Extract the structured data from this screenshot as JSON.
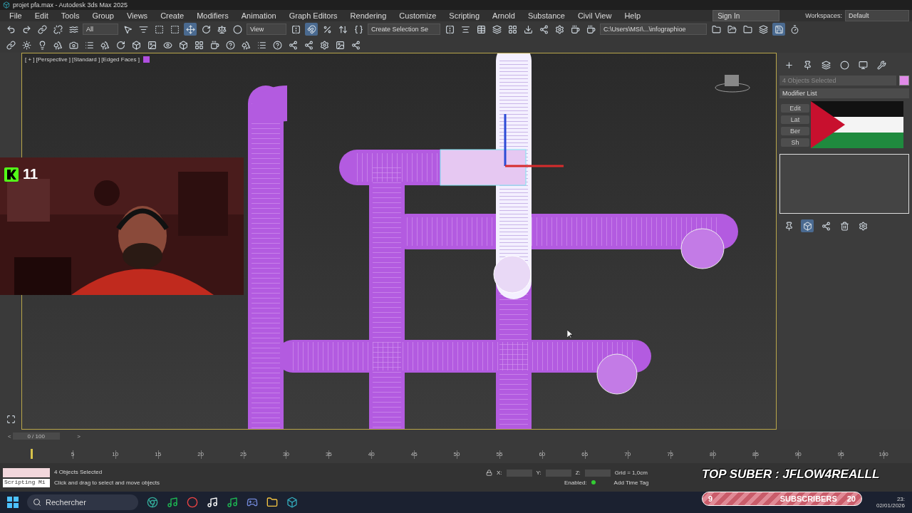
{
  "window": {
    "title": "projet pfa.max - Autodesk 3ds Max 2025"
  },
  "menu": [
    "File",
    "Edit",
    "Tools",
    "Group",
    "Views",
    "Create",
    "Modifiers",
    "Animation",
    "Graph Editors",
    "Rendering",
    "Customize",
    "Scripting",
    "Arnold",
    "Substance",
    "Civil View",
    "Help"
  ],
  "account": {
    "sign_in": "Sign In",
    "workspaces_label": "Workspaces:",
    "workspace": "Default"
  },
  "toolbar": {
    "selection_filter": "All",
    "reference_coord": "View",
    "named_selection": "Create Selection Se",
    "project_path": "C:\\Users\\MSI\\...\\infographioe"
  },
  "viewport": {
    "labels": [
      "[ + ]",
      "[Perspective ]",
      "[Standard ]",
      "[Edged Faces ]"
    ]
  },
  "webcam_overlay": {
    "count": "11"
  },
  "command_panel": {
    "selection": "4 Objects Selected",
    "modifier_list": "Modifier List",
    "modifier_buttons": [
      "Edit",
      "Lat",
      "Ber",
      "Sh"
    ]
  },
  "timeline": {
    "prev": "<",
    "frame": "0 / 100",
    "next": ">",
    "level": 0,
    "ticks": [
      "5",
      "10",
      "15",
      "20",
      "25",
      "30",
      "35",
      "40",
      "45",
      "50",
      "55",
      "60",
      "65",
      "70",
      "75",
      "80",
      "85",
      "90",
      "95",
      "100"
    ]
  },
  "status": {
    "script_listener": "Scripting Mi",
    "selection": "4 Objects Selected",
    "prompt": "Click and drag to select and move objects",
    "x_label": "X:",
    "y_label": "Y:",
    "z_label": "Z:",
    "grid": "Grid = 1,0cm",
    "enabled": "Enabled:",
    "time_tag": "Add Time Tag"
  },
  "stream_overlay": {
    "top_sub": "TOP SUBER : JFLOW4REALLL",
    "goal_count": "9",
    "goal_label": "SUBSCRIBERS",
    "goal_target": "20"
  },
  "taskbar": {
    "search": "Rechercher",
    "time": "23:",
    "date": "02/01/2026"
  }
}
